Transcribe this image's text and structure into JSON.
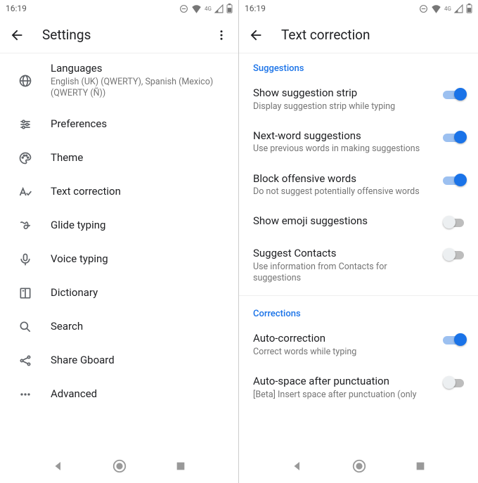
{
  "status": {
    "time": "16:19",
    "network_label": "4G"
  },
  "left": {
    "title": "Settings",
    "items": [
      {
        "key": "languages",
        "title": "Languages",
        "sub": "English (UK) (QWERTY), Spanish (Mexico) (QWERTY (Ñ))"
      },
      {
        "key": "preferences",
        "title": "Preferences"
      },
      {
        "key": "theme",
        "title": "Theme"
      },
      {
        "key": "text-correction",
        "title": "Text correction"
      },
      {
        "key": "glide-typing",
        "title": "Glide typing"
      },
      {
        "key": "voice-typing",
        "title": "Voice typing"
      },
      {
        "key": "dictionary",
        "title": "Dictionary"
      },
      {
        "key": "search",
        "title": "Search"
      },
      {
        "key": "share-gboard",
        "title": "Share Gboard"
      },
      {
        "key": "advanced",
        "title": "Advanced"
      }
    ]
  },
  "right": {
    "title": "Text correction",
    "section1": "Suggestions",
    "section2": "Corrections",
    "rows": {
      "show_suggestion_strip": {
        "title": "Show suggestion strip",
        "sub": "Display suggestion strip while typing",
        "on": true
      },
      "next_word": {
        "title": "Next-word suggestions",
        "sub": "Use previous words in making suggestions",
        "on": true
      },
      "block_offensive": {
        "title": "Block offensive words",
        "sub": "Do not suggest potentially offensive words",
        "on": true
      },
      "emoji": {
        "title": "Show emoji suggestions",
        "on": false
      },
      "contacts": {
        "title": "Suggest Contacts",
        "sub": "Use information from Contacts for suggestions",
        "on": false
      },
      "auto_correction": {
        "title": "Auto-correction",
        "sub": "Correct words while typing",
        "on": true
      },
      "auto_space": {
        "title": "Auto-space after punctuation",
        "sub": "[Beta] Insert space after punctuation (only",
        "on": false
      }
    }
  }
}
